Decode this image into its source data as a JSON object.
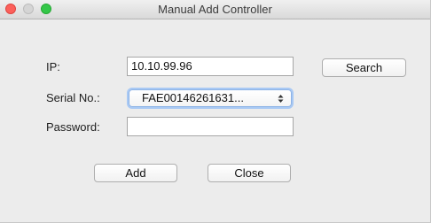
{
  "window": {
    "title": "Manual Add Controller"
  },
  "form": {
    "ip_label": "IP:",
    "ip_value": "10.10.99.96",
    "serial_label": "Serial No.:",
    "serial_selected": "FAE00146261631...",
    "password_label": "Password:",
    "password_value": ""
  },
  "buttons": {
    "search": "Search",
    "add": "Add",
    "close": "Close"
  },
  "icons": {
    "select_arrows": "↕"
  },
  "colors": {
    "close_light": "#fc605b",
    "minimize_light": "#d5d5d5",
    "maximize_light": "#34c749",
    "focus_ring": "#a9c9f4"
  }
}
